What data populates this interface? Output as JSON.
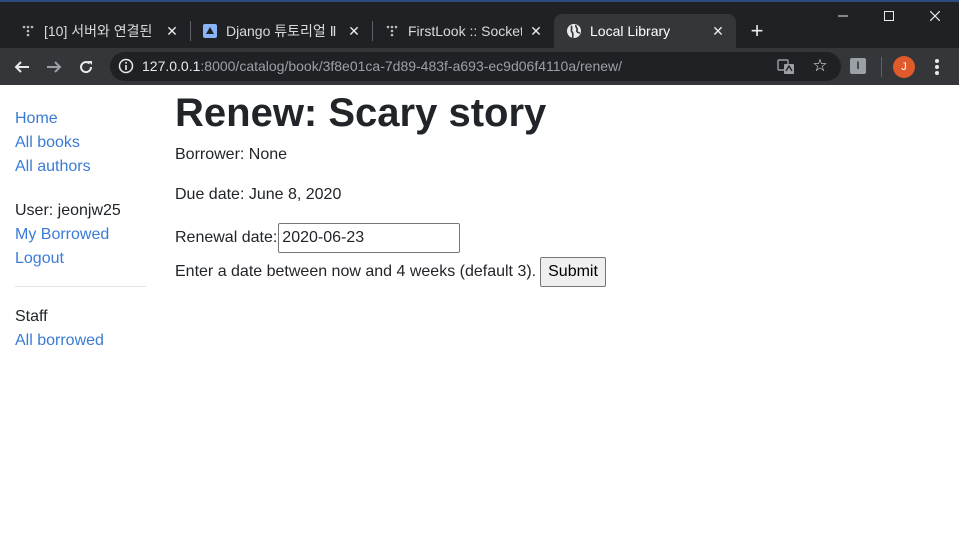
{
  "browser": {
    "tabs": [
      {
        "title": "[10] 서버와 연결된",
        "icon": "tistory-icon"
      },
      {
        "title": "Django 튜토리얼 Ⅱ",
        "icon": "mdn-icon"
      },
      {
        "title": "FirstLook :: Socket",
        "icon": "tistory-icon"
      },
      {
        "title": "Local Library",
        "icon": "globe-icon"
      }
    ],
    "url_host": "127.0.0.1",
    "url_rest": ":8000/catalog/book/3f8e01ca-7d89-483f-a693-ec9d06f4110a/renew/",
    "extension_label": "I",
    "avatar_initial": "J",
    "accent": "#e05a2b"
  },
  "sidebar": {
    "links": [
      {
        "label": "Home"
      },
      {
        "label": "All books"
      },
      {
        "label": "All authors"
      }
    ],
    "user_label": "User: jeonjw25",
    "my_borrowed": "My Borrowed",
    "logout": "Logout",
    "staff_label": "Staff",
    "all_borrowed": "All borrowed"
  },
  "main": {
    "title": "Renew: Scary story",
    "borrower": "Borrower: None",
    "due_date": "Due date: June 8, 2020",
    "renewal_label": "Renewal date:",
    "renewal_value": "2020-06-23",
    "help_text": "Enter a date between now and 4 weeks (default 3).",
    "submit_label": "Submit"
  }
}
